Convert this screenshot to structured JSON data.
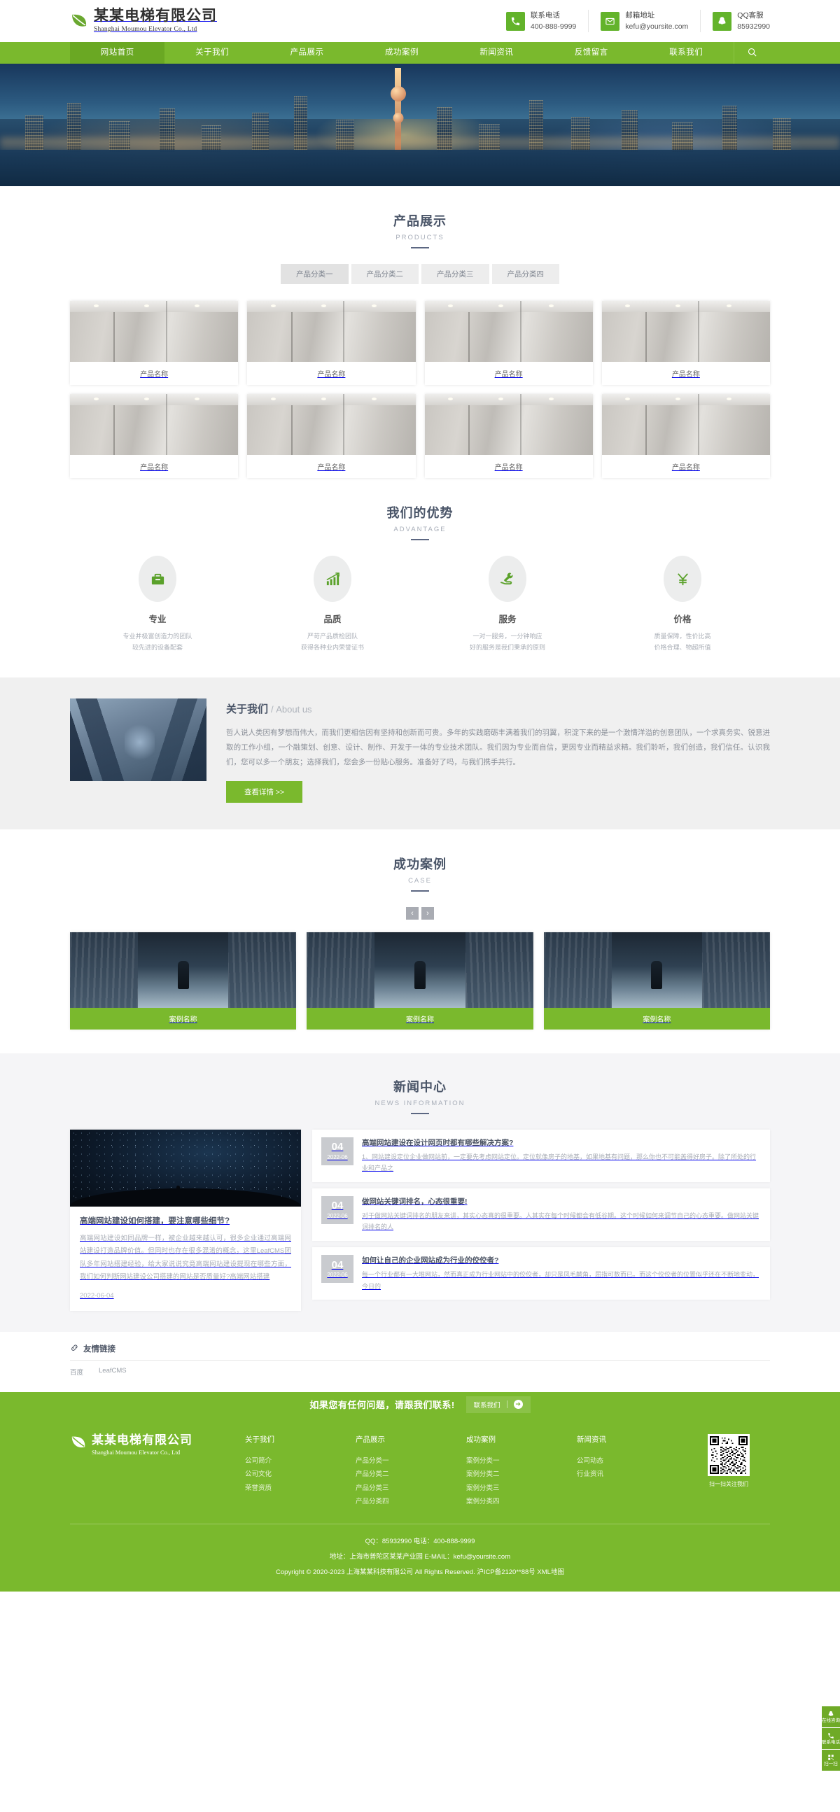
{
  "header": {
    "brand_cn": "某某电梯有限公司",
    "brand_en": "Shanghai Moumou Elevator Co., Ltd",
    "contacts": [
      {
        "icon": "phone-icon",
        "label": "联系电话",
        "value": "400-888-9999"
      },
      {
        "icon": "mail-icon",
        "label": "邮箱地址",
        "value": "kefu@yoursite.com"
      },
      {
        "icon": "qq-penguin-icon",
        "label": "QQ客服",
        "value": "85932990"
      }
    ]
  },
  "nav": {
    "items": [
      "网站首页",
      "关于我们",
      "产品展示",
      "成功案例",
      "新闻资讯",
      "反馈留言",
      "联系我们"
    ],
    "active_index": 0,
    "search_icon": "search-icon"
  },
  "products": {
    "title": "产品展示",
    "subtitle": "PRODUCTS",
    "tabs": [
      "产品分类一",
      "产品分类二",
      "产品分类三",
      "产品分类四"
    ],
    "active_tab": 0,
    "items": [
      {
        "name": "产品名称"
      },
      {
        "name": "产品名称"
      },
      {
        "name": "产品名称"
      },
      {
        "name": "产品名称"
      },
      {
        "name": "产品名称"
      },
      {
        "name": "产品名称"
      },
      {
        "name": "产品名称"
      },
      {
        "name": "产品名称"
      }
    ]
  },
  "advantage": {
    "title": "我们的优势",
    "subtitle": "ADVANTAGE",
    "items": [
      {
        "icon": "briefcase-icon",
        "title": "专业",
        "line1": "专业并极富创造力的团队",
        "line2": "较先进的设备配套"
      },
      {
        "icon": "growth-chart-icon",
        "title": "品质",
        "line1": "严苛产品质检团队",
        "line2": "获得各种业内荣誉证书"
      },
      {
        "icon": "wrench-hand-icon",
        "title": "服务",
        "line1": "一对一服务，一分钟响应",
        "line2": "好的服务是我们秉承的原则"
      },
      {
        "icon": "yen-icon",
        "title": "价格",
        "line1": "质量保障，性价比高",
        "line2": "价格合理、物超所值"
      }
    ]
  },
  "about": {
    "title_cn": "关于我们",
    "title_en": "/ About us",
    "body": "哲人说人类因有梦想而伟大，而我们更相信因有坚持和创新而可贵。多年的实践磨砺丰满着我们的羽翼，积淀下来的是一个激情洋溢的创意团队，一个求真务实、锐意进取的工作小组，一个融策划、创意、设计、制作、开发于一体的专业技术团队。我们因为专业而自信，更因专业而精益求精。我们聆听，我们创造，我们信任。认识我们，您可以多一个朋友；选择我们，您会多一份贴心服务。准备好了吗，与我们携手共行。",
    "button": "查看详情 >>"
  },
  "cases": {
    "title": "成功案例",
    "subtitle": "CASE",
    "prev": "‹",
    "next": "›",
    "items": [
      {
        "name": "案例名称"
      },
      {
        "name": "案例名称"
      },
      {
        "name": "案例名称"
      }
    ]
  },
  "news": {
    "title": "新闻中心",
    "subtitle": "NEWS INFORMATION",
    "featured": {
      "title": "高端网站建设如何搭建，要注意哪些细节?",
      "desc": "高端网站建设如同品牌一样，被企业越来越认可，很多企业通过高端网站建设打造品牌价值。但同时也存在很多混淆的概念，这里LeafCMS团队多年网站搭建经验，给大家说说究竟高端网站建设提现在哪些方面，我们如何判断网站建设公司搭建的网站是否质量好?高端网站搭建",
      "date": "2022-06-04"
    },
    "list": [
      {
        "day": "04",
        "month": "2022-06",
        "title": "高端网站建设在设计网页时都有哪些解决方案?",
        "desc": "1、网站建设定位企业做网站前，一定要先考虑网站定位。定位就像房子的地基，如果地基有问题，那么你也不可能盖得好房子。除了所处的行业和产品之"
      },
      {
        "day": "04",
        "month": "2022-06",
        "title": "做网站关键词排名，心态很重要!",
        "desc": "对于做网站关键词排名的朋友来讲，其实心态真的很重要。人其实在每个时候都会有低谷期。这个时候如何来调节自己的心态重要。做网站关键词排名的人"
      },
      {
        "day": "04",
        "month": "2022-06",
        "title": "如何让自己的企业网站成为行业的佼佼者?",
        "desc": "每一个行业都有一大堆网站，然而真正成为行业网站中的佼佼者，却只是凤毛麟角，屈指可数而已。而这个佼佼者的位置似乎还在不断地变动，今日的"
      }
    ]
  },
  "friendly_links": {
    "icon": "chain-link-icon",
    "title": "友情链接",
    "links": [
      "百度",
      "LeafCMS"
    ]
  },
  "cta": {
    "text": "如果您有任何问题，请跟我们联系!",
    "button": "联系我们",
    "arrow": "➔"
  },
  "footer": {
    "brand_cn": "某某电梯有限公司",
    "brand_en": "Shanghai Moumou Elevator Co., Ltd",
    "columns": [
      {
        "head": "关于我们",
        "links": [
          "公司简介",
          "公司文化",
          "荣誉资质"
        ]
      },
      {
        "head": "产品展示",
        "links": [
          "产品分类一",
          "产品分类二",
          "产品分类三",
          "产品分类四"
        ]
      },
      {
        "head": "成功案例",
        "links": [
          "案例分类一",
          "案例分类二",
          "案例分类三",
          "案例分类四"
        ]
      },
      {
        "head": "新闻资讯",
        "links": [
          "公司动态",
          "行业资讯"
        ]
      }
    ],
    "qr_caption": "扫一扫关注我们",
    "bottom_line1": "QQ：85932990   电话：400-888-9999",
    "bottom_line2": "地址：上海市普陀区某某产业园   E-MAIL：kefu@yoursite.com",
    "bottom_line3": "Copyright © 2020-2023 上海某某科技有限公司 All Rights Reserved. 沪ICP备2120**88号  XML地图"
  },
  "sidebar": [
    {
      "icon": "qq-penguin-icon",
      "label": "在线咨询"
    },
    {
      "icon": "phone-icon",
      "label": "联系电话"
    },
    {
      "icon": "qrcode-icon",
      "label": "扫一扫"
    }
  ],
  "colors": {
    "brand_green": "#7ab92d",
    "icon_green": "#63b32b",
    "heading": "#4a5568",
    "muted": "#a8adb6"
  }
}
